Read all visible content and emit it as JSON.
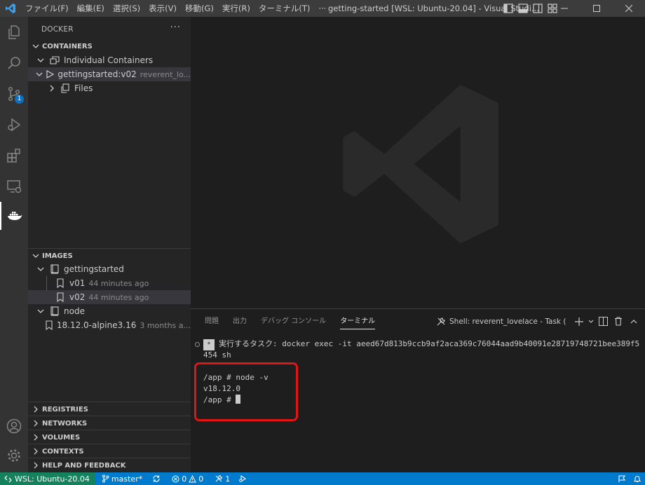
{
  "menu": [
    "ファイル(F)",
    "編集(E)",
    "選択(S)",
    "表示(V)",
    "移動(G)",
    "実行(R)",
    "ターミナル(T)",
    "···"
  ],
  "window_title": "getting-started [WSL: Ubuntu-20.04] - Visual Studi...",
  "activity": {
    "scm_badge": "1"
  },
  "sidebar": {
    "title": "DOCKER",
    "more": "···",
    "containers": {
      "header": "CONTAINERS",
      "group": "Individual Containers",
      "container": {
        "name": "gettingstarted:v02",
        "desc": "reverent_lo..."
      },
      "files": "Files"
    },
    "images": {
      "header": "IMAGES",
      "repos": [
        {
          "name": "gettingstarted",
          "tags": [
            {
              "tag": "v01",
              "desc": "44 minutes ago"
            },
            {
              "tag": "v02",
              "desc": "44 minutes ago"
            }
          ]
        },
        {
          "name": "node",
          "tags": [
            {
              "tag": "18.12.0-alpine3.16",
              "desc": "3 months a..."
            }
          ]
        }
      ]
    },
    "collapsed_sections": [
      "REGISTRIES",
      "NETWORKS",
      "VOLUMES",
      "CONTEXTS",
      "HELP AND FEEDBACK"
    ]
  },
  "panel": {
    "tabs": [
      "問題",
      "出力",
      "デバッグ コンソール",
      "ターミナル"
    ],
    "terminal_name": "Shell: reverent_lovelace - Task (",
    "terminal": {
      "task_tag": "*",
      "task_line1": "実行するタスク: docker exec -it aeed67d813b9ccb9af2aca369c76044aad9b40091e28719748721bee389f5",
      "task_line2": "454 sh",
      "cmd": "/app # node -v",
      "output": "v18.12.0",
      "prompt": "/app # "
    }
  },
  "statusbar": {
    "remote": "WSL: Ubuntu-20.04",
    "branch": "master*",
    "errors": "0",
    "warnings": "0",
    "ports": "1"
  },
  "colors": {
    "accent": "#007acc",
    "remote": "#16825d",
    "highlight": "#e21414"
  }
}
